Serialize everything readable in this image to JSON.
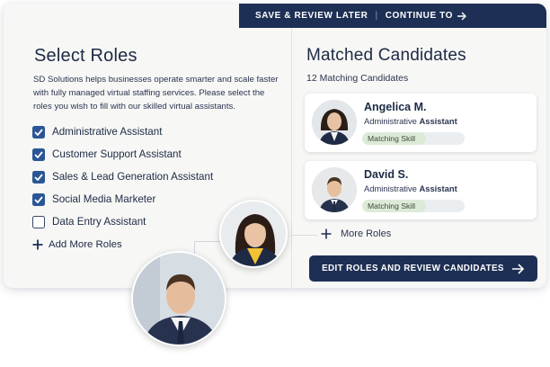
{
  "topbar": {
    "save_label": "SAVE & REVIEW LATER",
    "separator": "|",
    "continue_label": "CONTINUE TO"
  },
  "left": {
    "title": "Select Roles",
    "description": "SD Solutions helps businesses operate smarter and scale faster with fully managed virtual staffing services. Please select the roles you wish to fill with our skilled virtual assistants.",
    "roles": [
      {
        "label": "Administrative Assistant",
        "checked": true
      },
      {
        "label": "Customer Support Assistant",
        "checked": true
      },
      {
        "label": "Sales & Lead Generation Assistant",
        "checked": true
      },
      {
        "label": "Social Media Marketer",
        "checked": true
      },
      {
        "label": "Data Entry Assistant",
        "checked": false
      }
    ],
    "add_more_label": "Add More Roles"
  },
  "right": {
    "title": "Matched Candidates",
    "count_text": "12 Matching Candidates",
    "candidates": [
      {
        "name": "Angelica M.",
        "role_prefix": "Administrative",
        "role_bold": "Assistant",
        "skill_label": "Matching Skill",
        "skill_level": 0.62
      },
      {
        "name": "David S.",
        "role_prefix": "Administrative",
        "role_bold": "Assistant",
        "skill_label": "Matching Skill",
        "skill_level": 0.62
      }
    ],
    "more_roles_label": "More Roles",
    "edit_button_label": "EDIT ROLES AND REVIEW CANDIDATES"
  },
  "colors": {
    "navy": "#1e2f55",
    "checkbox_blue": "#2b5696",
    "skill_green": "#dcebd8"
  },
  "icons": [
    "arrow-right-icon",
    "checkmark-icon",
    "plus-icon"
  ]
}
